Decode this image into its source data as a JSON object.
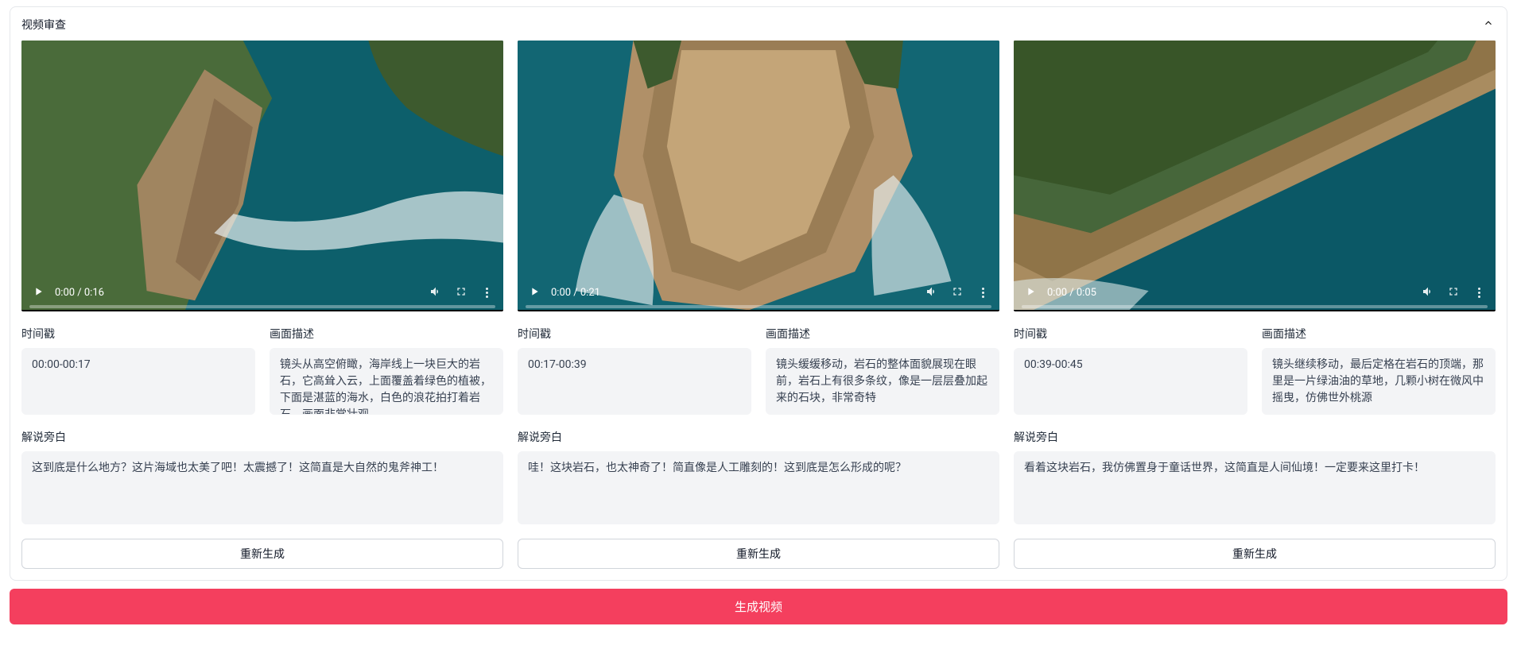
{
  "panel": {
    "title": "视频审查"
  },
  "labels": {
    "timestamp": "时间戳",
    "scene_desc": "画面描述",
    "narration": "解说旁白",
    "regenerate": "重新生成"
  },
  "clips": [
    {
      "time_display": "0:00 / 0:16",
      "timestamp": "00:00-00:17",
      "scene_desc": "镜头从高空俯瞰，海岸线上一块巨大的岩石，它高耸入云，上面覆盖着绿色的植被，下面是湛蓝的海水，白色的浪花拍打着岩石，画面非常壮观",
      "narration": "这到底是什么地方？这片海域也太美了吧！太震撼了！这简直是大自然的鬼斧神工！"
    },
    {
      "time_display": "0:00 / 0:21",
      "timestamp": "00:17-00:39",
      "scene_desc": "镜头缓缓移动，岩石的整体面貌展现在眼前，岩石上有很多条纹，像是一层层叠加起来的石块，非常奇特",
      "narration": "哇！这块岩石，也太神奇了！简直像是人工雕刻的！这到底是怎么形成的呢？"
    },
    {
      "time_display": "0:00 / 0:05",
      "timestamp": "00:39-00:45",
      "scene_desc": "镜头继续移动，最后定格在岩石的顶端，那里是一片绿油油的草地，几颗小树在微风中摇曳，仿佛世外桃源",
      "narration": "看着这块岩石，我仿佛置身于童话世界，这简直是人间仙境！一定要来这里打卡！"
    }
  ],
  "generate_label": "生成视频"
}
